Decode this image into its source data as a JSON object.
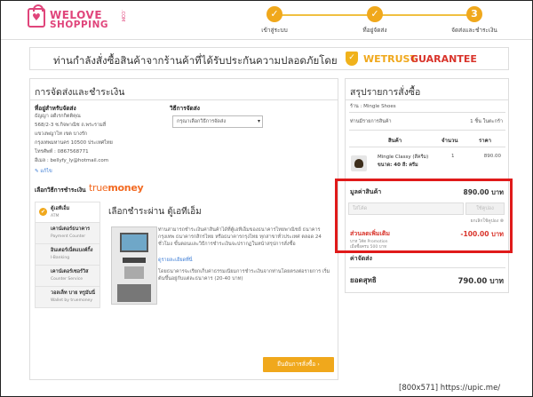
{
  "logo": {
    "line1": "WELOVE",
    "line2": "SHOPPING",
    "com": ".COM"
  },
  "steps": [
    {
      "num": "✓",
      "label": "เข้าสู่ระบบ"
    },
    {
      "num": "✓",
      "label": "ที่อยู่จัดส่ง"
    },
    {
      "num": "3",
      "label": "จัดส่งและชำระเงิน"
    }
  ],
  "banner": {
    "text": "ท่านกำลังสั่งซื้อสินค้าจากร้านค้าที่ได้รับประกันความปลอดภัยโดย",
    "shield_glyph": "✓",
    "brand_a": "WETRUST",
    "brand_b": "GUARANTEE"
  },
  "left_panel": {
    "title": "การจัดส่งและชำระเงิน",
    "address_heading": "ที่อยู่สำหรับจัดส่ง",
    "address_lines": [
      "ธัญญา อดีเรกกิตติคุณ",
      "568/2-3 ซ.กิจพาณิช ถ.พระรามสี่",
      "แขวงพญาไท เขต บางรัก",
      "กรุงเทพมหานคร 10500 ประเทศไทย",
      "โทรศัพท์ : 0867568771",
      "อีเมล : bellyfy_ly@hotmail.com"
    ],
    "edit_link": "✎ แก้ไข",
    "shipping_heading": "วิธีการจัดส่ง",
    "shipping_select": "กรุณาเลือกวิธีการจัดส่ง",
    "payment_heading": "เลือกวิธีการชำระเงิน",
    "truemoney_a": "true",
    "truemoney_b": "money",
    "payment_methods": [
      {
        "name": "ตู้เอทีเอ็ม",
        "sub": "ATM"
      },
      {
        "name": "เคาน์เตอร์ธนาคาร",
        "sub": "Payment Counter"
      },
      {
        "name": "อินเตอร์เน็ตแบงค์กิ้ง",
        "sub": "I-Banking"
      },
      {
        "name": "เคาน์เตอร์เซอร์วิส",
        "sub": "Counter Service"
      },
      {
        "name": "วอลเล็ท บาย ทรูมันนี่",
        "sub": "Wallet by truemoney"
      }
    ],
    "atm_heading": "เลือกชำระผ่าน ตู้เอทีเอ็ม",
    "atm_text1": "ท่านสามารถชำระเงินค่าสินค้าได้ที่ตู้เอทีเอ็มของธนาคารไทยพาณิชย์ ธนาคารกรุงเทพ ธนาคารกสิกรไทย หรือธนาคารกรุงไทย ทุกสาขาทั่วประเทศ ตลอด 24 ชั่วโมง ขั้นตอนและวิธีการชำระเงินจะปรากฏในหน้าสรุปการสั่งซื้อ",
    "atm_link": "ดูรายละเอียดที่นี่",
    "atm_text2": "โดยธนาคารจะเรียกเก็บค่าธรรมเนียมการชำระเงินจากท่านโดยตรงต่อรายการ เริ่มต้นขึ้นอยู่กับแต่ละธนาคาร (20-40 บาท)",
    "confirm_button": "ยืนยันการสั่งซื้อ ›"
  },
  "summary": {
    "title": "สรุปรายการสั่งซื้อ",
    "shop_label": "ร้าน : Mingle Shoes",
    "item_count_label": "ท่านมีรายการสินค้า",
    "item_count_value": "1 ชิ้น ในตะกร้า",
    "col_product": "สินค้า",
    "col_qty": "จำนวน",
    "col_price": "ราคา",
    "product_name": "Mingle Classy (สีครีม)",
    "product_size": "ขนาด: 40 สี: ครีม",
    "product_qty": "1",
    "product_price": "890.00",
    "subtotal_label": "มูลค่าสินค้า",
    "subtotal_value": "890.00 บาท",
    "coupon_placeholder": "ใส่โค้ด",
    "coupon_button": "ใช้คูปอง",
    "coupon_link": "ยกเลิกใช้คูปอง ⊗",
    "discount_label": "ส่วนลดเพิ่มเติม",
    "discount_value": "-100.00 บาท",
    "discount_note1": "บาท โค้ด Promotion",
    "discount_note2": "เมื่อซื้อครบ 500 บาท",
    "shipping_label": "ค่าจัดส่ง",
    "total_label": "ยอดสุทธิ",
    "total_value": "790.00 บาท"
  },
  "watermark": "[800x571] https://upic.me/",
  "colors": {
    "accent": "#f0a81c",
    "brand": "#e0457b",
    "highlight": "#e01a1a",
    "discount": "#d9342b"
  }
}
